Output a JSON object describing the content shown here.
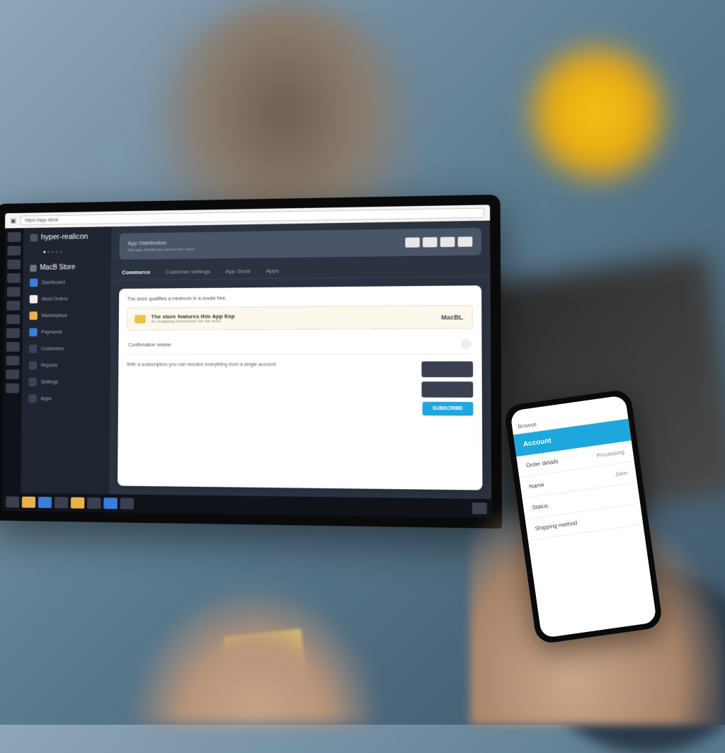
{
  "browser": {
    "address": "https://app.store"
  },
  "sidebar": {
    "brand": "hyper-realicon",
    "section": "MacB Store",
    "items": [
      {
        "label": "Dashboard"
      },
      {
        "label": "Most Orders"
      },
      {
        "label": "Marketplace"
      },
      {
        "label": "Payments"
      },
      {
        "label": "Customers"
      },
      {
        "label": "Reports"
      },
      {
        "label": "Settings"
      },
      {
        "label": "Apps"
      }
    ]
  },
  "banner": {
    "title": "App Distribution",
    "subtitle": "Manage distribution across the store"
  },
  "tabs": [
    {
      "label": "Commerce",
      "active": true
    },
    {
      "label": "Customer settings",
      "active": false
    },
    {
      "label": "App Store",
      "active": false
    },
    {
      "label": "Apps",
      "active": false
    }
  ],
  "card": {
    "head": "The store qualifies a minimum in a model free.",
    "promo_title": "The store features this App Exp",
    "promo_sub": "An engaging introduction for the store.",
    "promo_brand": "MacBL",
    "row1_label": "Confirmation review",
    "note": "With a subscription you can monitor everything from a single account.",
    "cta": "SUBSCRIBE"
  },
  "phone": {
    "tab": "Browse",
    "hero": "Account",
    "rows": [
      {
        "label": "Order details",
        "value": "Processing"
      },
      {
        "label": "Name",
        "value": "John"
      },
      {
        "label": "Status",
        "value": ""
      },
      {
        "label": "Shipping method",
        "value": ""
      }
    ]
  }
}
